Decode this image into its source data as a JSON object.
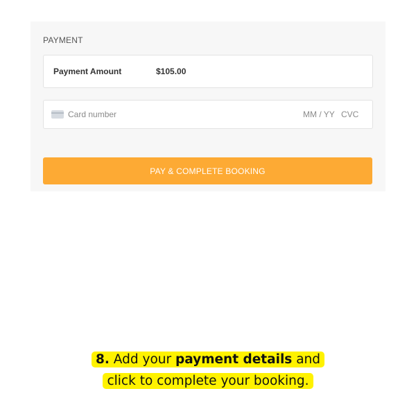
{
  "payment": {
    "section_title": "PAYMENT",
    "amount_label": "Payment Amount",
    "amount_value": "$105.00",
    "card_number_placeholder": "Card number",
    "expiry_placeholder": "MM / YY",
    "cvc_placeholder": "CVC",
    "pay_button_label": "PAY & COMPLETE BOOKING",
    "card_icon": "credit-card-icon",
    "button_color": "#fdaa34"
  },
  "caption": {
    "step_number": "8.",
    "text_before": "Add your",
    "bold_text": "payment details",
    "text_after_line1": "and",
    "line2": "click to complete your booking.",
    "highlight_color": "#fff200"
  }
}
